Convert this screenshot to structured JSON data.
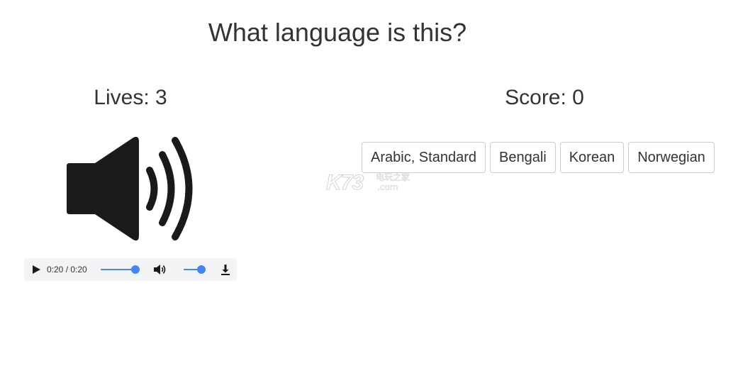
{
  "header": {
    "title": "What language is this?"
  },
  "status": {
    "lives_label": "Lives: 3",
    "lives": 3,
    "score_label": "Score: 0",
    "score": 0
  },
  "audio": {
    "icon": "speaker-icon",
    "time_display": "0:20 / 0:20",
    "progress_fraction": 1.0,
    "volume_fraction": 1.0,
    "controls": [
      "play-icon",
      "volume-icon",
      "download-icon"
    ],
    "accent_color": "#4285f4"
  },
  "options": [
    {
      "label": "Arabic, Standard"
    },
    {
      "label": "Bengali"
    },
    {
      "label": "Korean"
    },
    {
      "label": "Norwegian"
    }
  ],
  "watermark": {
    "brand": "K73",
    "chinese": "电玩之家",
    "domain": ".com"
  }
}
